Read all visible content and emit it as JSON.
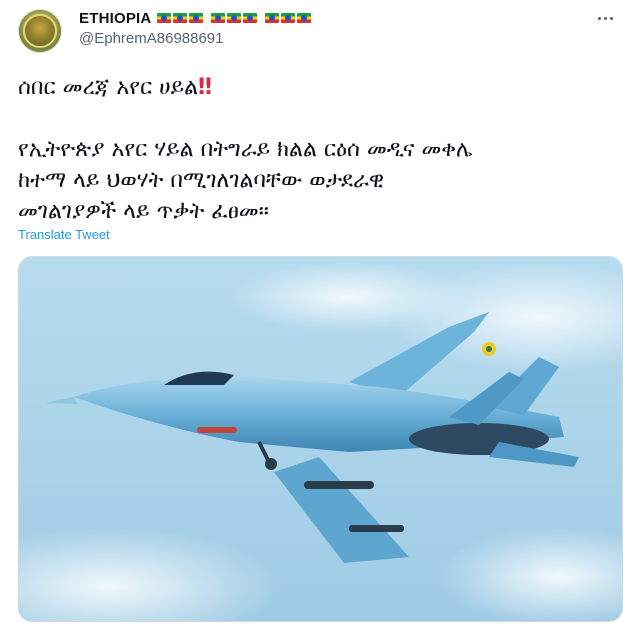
{
  "account": {
    "display_name": "ETHIOPIA",
    "handle": "@EphremA86988691",
    "flag_emoji_count": 9
  },
  "tweet": {
    "line_1": "ሰበር መረጃ አየር ሀይል",
    "line_1_emoji": "‼",
    "line_2": "የኢትዮጵያ አየር ሃይል በትግራይ ክልል ርዕሰ መዲና መቀሌ",
    "line_3": "ከተማ ላይ ህወሃት በሚገለገልባቸው ወታደራዊ",
    "line_4": "መገልገያዎች ላይ ጥቃት ፈፀመ።",
    "translate_label": "Translate Tweet"
  },
  "media": {
    "description_icon": "fighter-jet-photo",
    "sky_color": "#a9d3ea",
    "jet_color": "#6fb3d6"
  },
  "icons": {
    "more": "more-dots-icon",
    "avatar": "emblem-avatar"
  }
}
